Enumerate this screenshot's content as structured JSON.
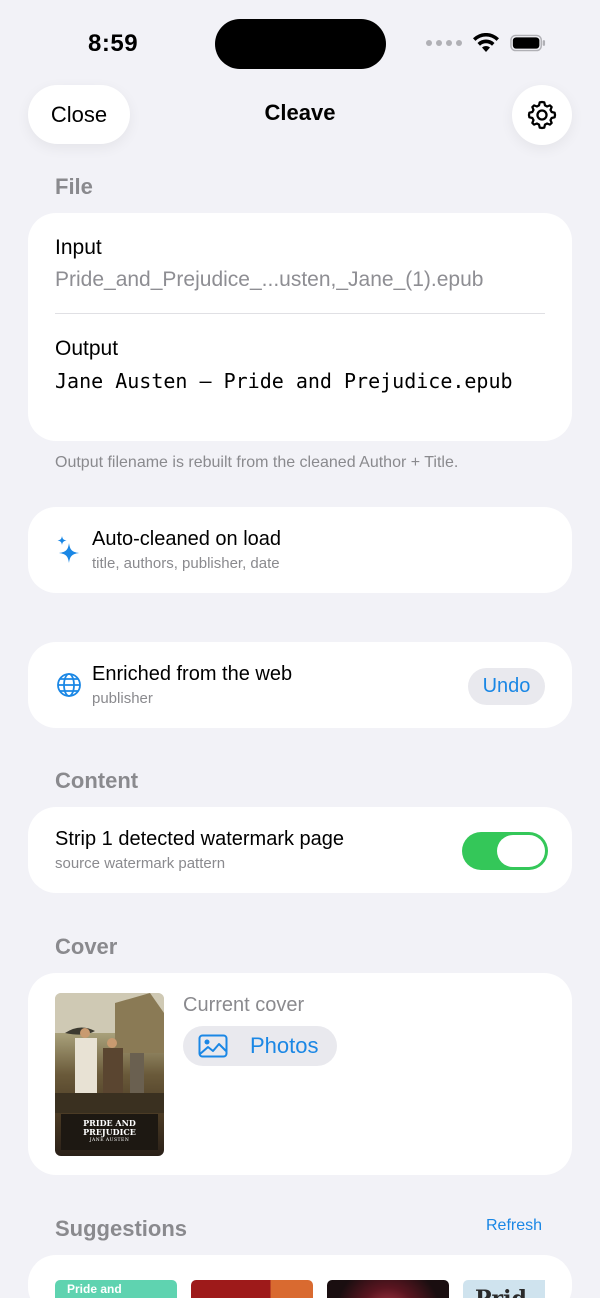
{
  "status": {
    "time": "8:59"
  },
  "nav": {
    "close_label": "Close",
    "title": "Cleave",
    "settings_icon": "gear-icon"
  },
  "file": {
    "header": "File",
    "input_label": "Input",
    "input_value": "Pride_and_Prejudice_...usten,_Jane_(1).epub",
    "output_label": "Output",
    "output_value": "Jane Austen – Pride and Prejudice.epub",
    "footnote": "Output filename is rebuilt from the cleaned Author + Title."
  },
  "auto_clean": {
    "icon": "sparkles-icon",
    "title": "Auto-cleaned on load",
    "subtitle": "title, authors, publisher, date"
  },
  "enriched": {
    "icon": "globe-icon",
    "title": "Enriched from the web",
    "subtitle": "publisher",
    "undo_label": "Undo"
  },
  "content": {
    "header": "Content",
    "strip_title": "Strip 1 detected watermark page",
    "strip_subtitle": "source watermark pattern",
    "strip_enabled": true
  },
  "cover": {
    "header": "Cover",
    "thumb_title": "PRIDE AND PREJUDICE",
    "thumb_author": "JANE AUSTEN",
    "current_label": "Current cover",
    "photos_icon": "photo-icon",
    "photos_label": "Photos"
  },
  "suggestions": {
    "header": "Suggestions",
    "refresh_label": "Refresh",
    "items": [
      {
        "text": "Pride and",
        "color": "#5fd3b0"
      },
      {
        "text": "",
        "color": "#9e1a1a"
      },
      {
        "text": "",
        "color": "#1a0e10"
      },
      {
        "text": "Prid",
        "color": "#cfe3ee"
      }
    ]
  },
  "colors": {
    "accent": "#1a87e5",
    "toggle_on": "#34c759",
    "background": "#f2f2f7"
  }
}
